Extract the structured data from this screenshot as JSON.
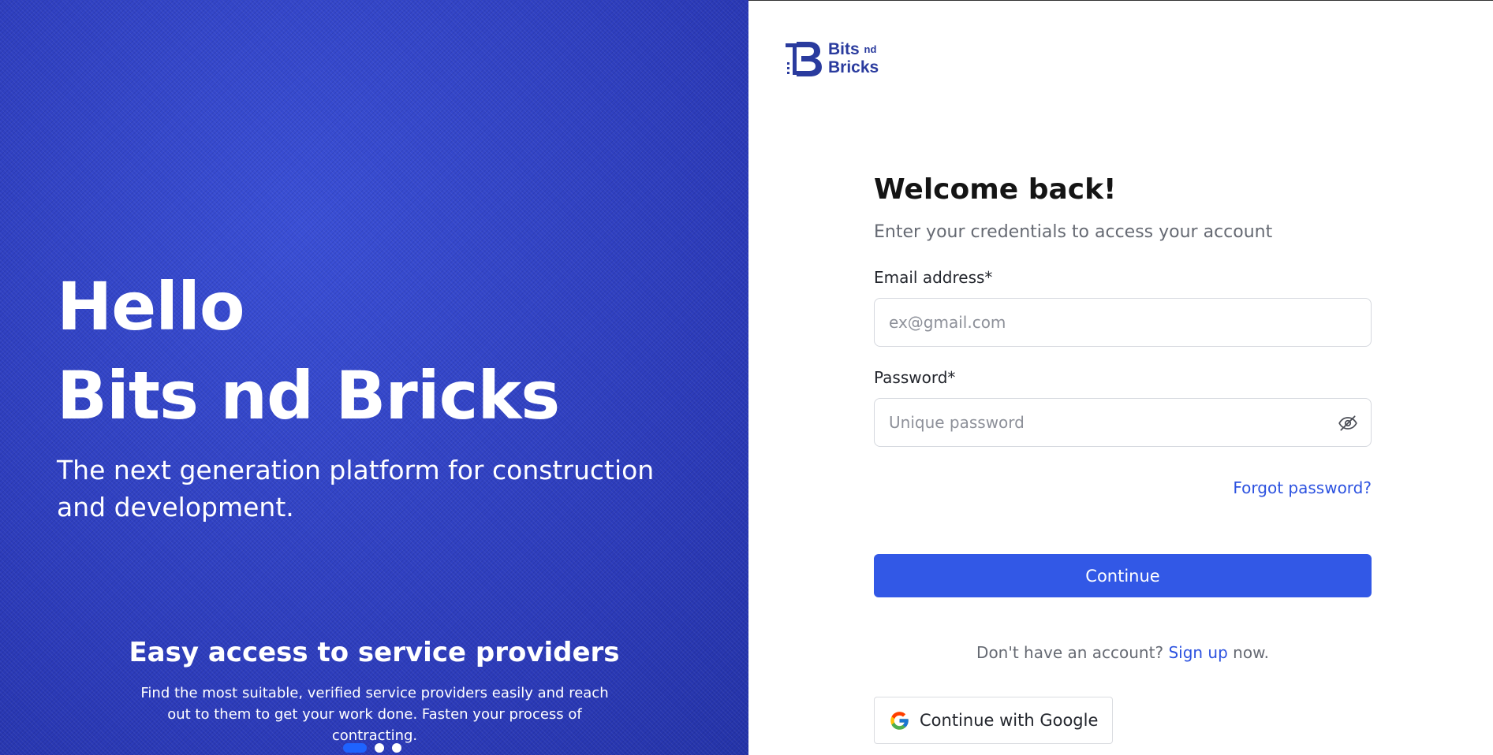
{
  "hero": {
    "title_line1": "Hello",
    "title_line2": "Bits nd Bricks",
    "subtitle": "The next generation platform for construction and development.",
    "slide": {
      "heading": "Easy access to service providers",
      "text": "Find the most suitable, verified service providers easily and reach out to them to get your work done. Fasten your process of contracting."
    },
    "dots": {
      "count": 3,
      "active_index": 0
    }
  },
  "logo": {
    "line1": "Bits",
    "line1_small": "nd",
    "line2": "Bricks",
    "icon": "bits-nd-bricks-logo-icon"
  },
  "form": {
    "heading": "Welcome back!",
    "subheading": "Enter your credentials to access your account",
    "email": {
      "label": "Email address*",
      "placeholder": "ex@gmail.com",
      "value": ""
    },
    "password": {
      "label": "Password*",
      "placeholder": "Unique password",
      "value": "",
      "toggle_icon": "eye-off-icon"
    },
    "forgot_label": "Forgot password?",
    "continue_label": "Continue",
    "signup": {
      "prefix": "Don't have an account?",
      "link": "Sign up",
      "suffix": "now."
    },
    "google": {
      "label": "Continue with Google",
      "icon": "google-icon"
    }
  },
  "colors": {
    "hero_bg": "#2f40c4",
    "primary": "#3258e6",
    "link": "#2c52e0",
    "logo": "#2a3b9e",
    "dot_active": "#1e63ff"
  }
}
